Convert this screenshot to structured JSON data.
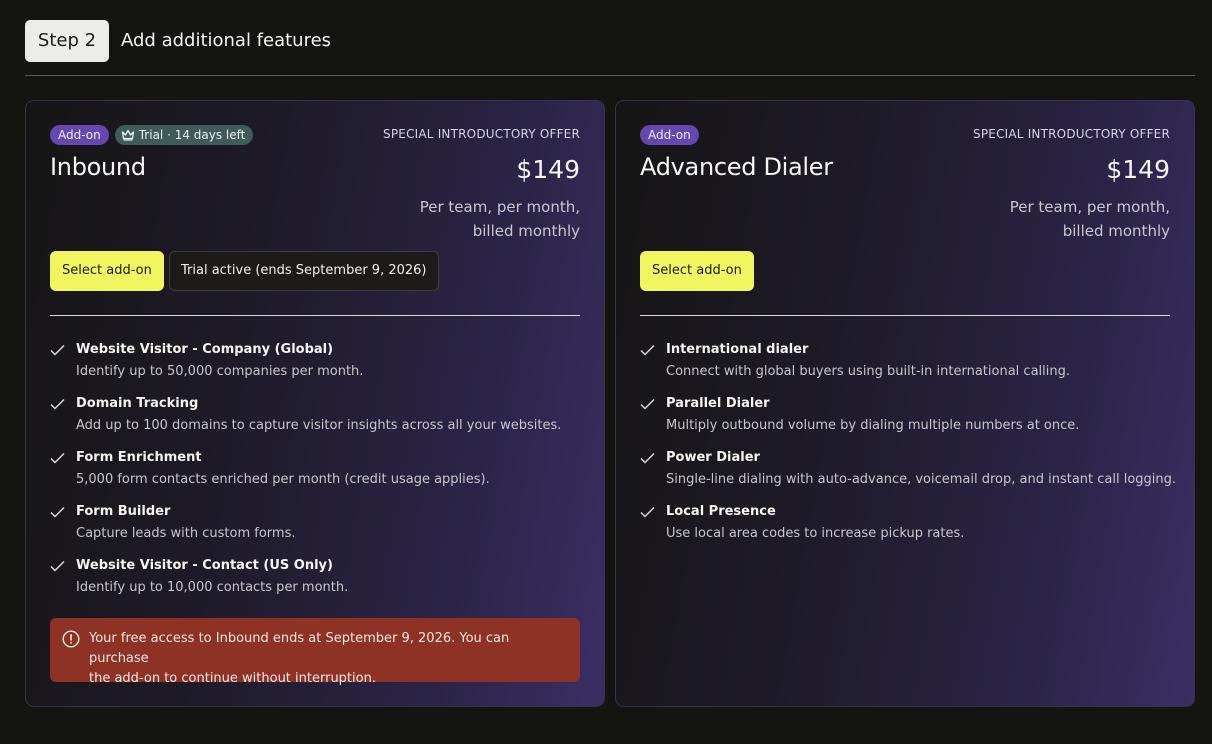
{
  "header": {
    "step_label": "Step 2",
    "title": "Add additional features"
  },
  "cards": [
    {
      "tag_addon": "Add-on",
      "tag_trial": "Trial · 14 days left",
      "offer": "SPECIAL INTRODUCTORY OFFER",
      "name": "Inbound",
      "price": "$149",
      "price_note_line1": "Per team, per month,",
      "price_note_line2": "billed monthly",
      "select_label": "Select add-on",
      "trial_status": "Trial active (ends September 9, 2026)",
      "features": [
        {
          "title": "Website Visitor - Company (Global)",
          "desc": "Identify up to 50,000 companies per month."
        },
        {
          "title": "Domain Tracking",
          "desc": "Add up to 100 domains to capture visitor insights across all your websites."
        },
        {
          "title": "Form Enrichment",
          "desc": "5,000 form contacts enriched per month (credit usage applies)."
        },
        {
          "title": "Form Builder",
          "desc": "Capture leads with custom forms."
        },
        {
          "title": "Website Visitor - Contact (US Only)",
          "desc": "Identify up to 10,000 contacts per month."
        }
      ],
      "notice_line1": "Your free access to Inbound ends at September 9, 2026. You can purchase",
      "notice_line2": "the add-on to continue without interruption."
    },
    {
      "tag_addon": "Add-on",
      "offer": "SPECIAL INTRODUCTORY OFFER",
      "name": "Advanced Dialer",
      "price": "$149",
      "price_note_line1": "Per team, per month,",
      "price_note_line2": "billed monthly",
      "select_label": "Select add-on",
      "features": [
        {
          "title": "International dialer",
          "desc": "Connect with global buyers using built-in international calling."
        },
        {
          "title": "Parallel Dialer",
          "desc": "Multiply outbound volume by dialing multiple numbers at once."
        },
        {
          "title": "Power Dialer",
          "desc": "Single-line dialing with auto-advance, voicemail drop, and instant call logging."
        },
        {
          "title": "Local Presence",
          "desc": "Use local area codes to increase pickup rates."
        }
      ]
    }
  ],
  "colors": {
    "select_button": "#f1f560",
    "addon_tag": "#6647b0",
    "trial_tag": "#3f5b5a",
    "notice": "#8f3226"
  },
  "icons": {
    "trial": "crown-icon",
    "feature": "check-icon",
    "notice": "alert-circle-icon"
  }
}
